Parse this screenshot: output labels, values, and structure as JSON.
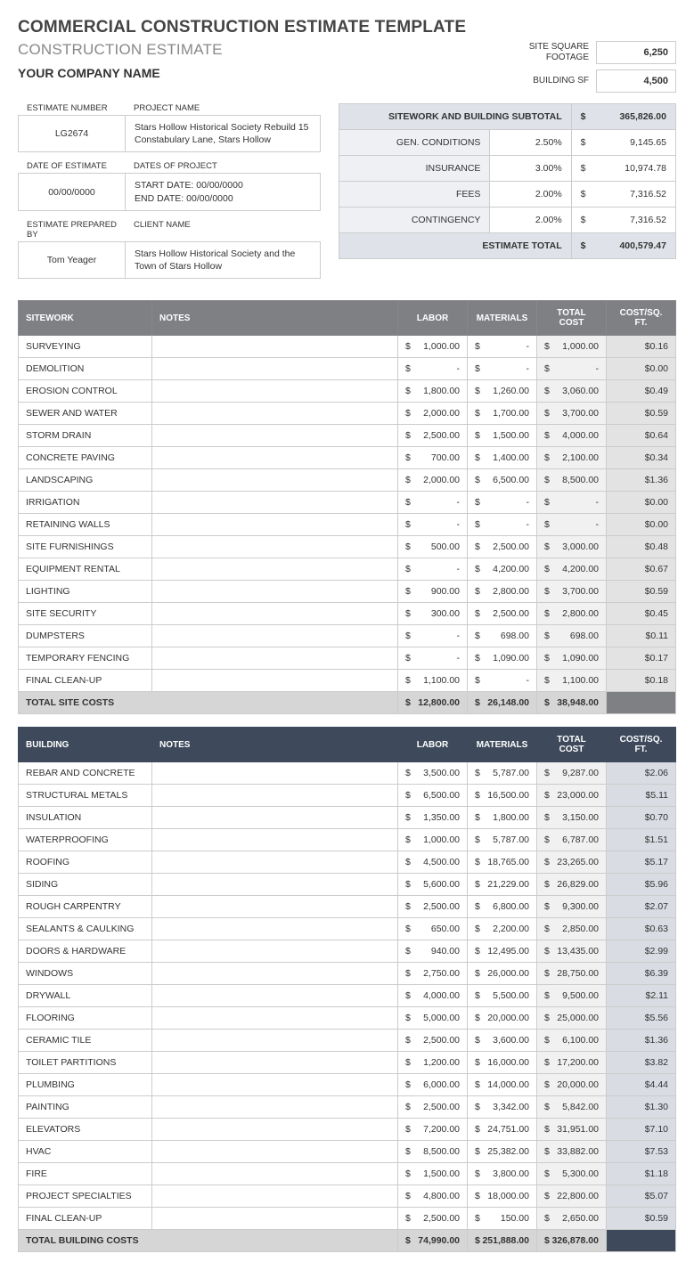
{
  "title": "COMMERCIAL CONSTRUCTION ESTIMATE TEMPLATE",
  "subtitle": "CONSTRUCTION ESTIMATE",
  "company": "YOUR COMPANY NAME",
  "sf": {
    "site_label": "SITE SQUARE FOOTAGE",
    "site_value": "6,250",
    "bldg_label": "BUILDING SF",
    "bldg_value": "4,500"
  },
  "meta": {
    "est_num_h": "ESTIMATE NUMBER",
    "proj_name_h": "PROJECT NAME",
    "est_num": "LG2674",
    "proj_name": "Stars Hollow Historical Society Rebuild 15 Constabulary Lane, Stars Hollow",
    "doe_h": "DATE OF ESTIMATE",
    "dop_h": "DATES OF PROJECT",
    "doe": "00/00/0000",
    "dop": "START DATE: 00/00/0000\nEND DATE: 00/00/0000",
    "prep_h": "ESTIMATE PREPARED BY",
    "client_h": "CLIENT NAME",
    "prep": "Tom Yeager",
    "client": "Stars Hollow Historical Society and the Town of Stars Hollow"
  },
  "summary": {
    "subtotal_label": "SITEWORK AND BUILDING SUBTOTAL",
    "subtotal": "365,826.00",
    "rows": [
      {
        "label": "GEN. CONDITIONS",
        "pct": "2.50%",
        "amt": "9,145.65"
      },
      {
        "label": "INSURANCE",
        "pct": "3.00%",
        "amt": "10,974.78"
      },
      {
        "label": "FEES",
        "pct": "2.00%",
        "amt": "7,316.52"
      },
      {
        "label": "CONTINGENCY",
        "pct": "2.00%",
        "amt": "7,316.52"
      }
    ],
    "total_label": "ESTIMATE TOTAL",
    "total": "400,579.47"
  },
  "cols": {
    "labor": "LABOR",
    "materials": "MATERIALS",
    "total": "TOTAL COST",
    "sqft": "COST/SQ. FT.",
    "notes": "NOTES"
  },
  "sitework": {
    "title": "SITEWORK",
    "rows": [
      {
        "name": "SURVEYING",
        "labor": "1,000.00",
        "materials": "-",
        "total": "1,000.00",
        "sqft": "$0.16"
      },
      {
        "name": "DEMOLITION",
        "labor": "-",
        "materials": "-",
        "total": "-",
        "sqft": "$0.00"
      },
      {
        "name": "EROSION CONTROL",
        "labor": "1,800.00",
        "materials": "1,260.00",
        "total": "3,060.00",
        "sqft": "$0.49"
      },
      {
        "name": "SEWER AND WATER",
        "labor": "2,000.00",
        "materials": "1,700.00",
        "total": "3,700.00",
        "sqft": "$0.59"
      },
      {
        "name": "STORM DRAIN",
        "labor": "2,500.00",
        "materials": "1,500.00",
        "total": "4,000.00",
        "sqft": "$0.64"
      },
      {
        "name": "CONCRETE PAVING",
        "labor": "700.00",
        "materials": "1,400.00",
        "total": "2,100.00",
        "sqft": "$0.34"
      },
      {
        "name": "LANDSCAPING",
        "labor": "2,000.00",
        "materials": "6,500.00",
        "total": "8,500.00",
        "sqft": "$1.36"
      },
      {
        "name": "IRRIGATION",
        "labor": "-",
        "materials": "-",
        "total": "-",
        "sqft": "$0.00"
      },
      {
        "name": "RETAINING WALLS",
        "labor": "-",
        "materials": "-",
        "total": "-",
        "sqft": "$0.00"
      },
      {
        "name": "SITE FURNISHINGS",
        "labor": "500.00",
        "materials": "2,500.00",
        "total": "3,000.00",
        "sqft": "$0.48"
      },
      {
        "name": "EQUIPMENT RENTAL",
        "labor": "-",
        "materials": "4,200.00",
        "total": "4,200.00",
        "sqft": "$0.67"
      },
      {
        "name": "LIGHTING",
        "labor": "900.00",
        "materials": "2,800.00",
        "total": "3,700.00",
        "sqft": "$0.59"
      },
      {
        "name": "SITE SECURITY",
        "labor": "300.00",
        "materials": "2,500.00",
        "total": "2,800.00",
        "sqft": "$0.45"
      },
      {
        "name": "DUMPSTERS",
        "labor": "-",
        "materials": "698.00",
        "total": "698.00",
        "sqft": "$0.11"
      },
      {
        "name": "TEMPORARY FENCING",
        "labor": "-",
        "materials": "1,090.00",
        "total": "1,090.00",
        "sqft": "$0.17"
      },
      {
        "name": "FINAL CLEAN-UP",
        "labor": "1,100.00",
        "materials": "-",
        "total": "1,100.00",
        "sqft": "$0.18"
      }
    ],
    "total_row": {
      "name": "TOTAL SITE COSTS",
      "labor": "12,800.00",
      "materials": "26,148.00",
      "total": "38,948.00"
    }
  },
  "building": {
    "title": "BUILDING",
    "rows": [
      {
        "name": "REBAR AND CONCRETE",
        "labor": "3,500.00",
        "materials": "5,787.00",
        "total": "9,287.00",
        "sqft": "$2.06"
      },
      {
        "name": "STRUCTURAL METALS",
        "labor": "6,500.00",
        "materials": "16,500.00",
        "total": "23,000.00",
        "sqft": "$5.11"
      },
      {
        "name": "INSULATION",
        "labor": "1,350.00",
        "materials": "1,800.00",
        "total": "3,150.00",
        "sqft": "$0.70"
      },
      {
        "name": "WATERPROOFING",
        "labor": "1,000.00",
        "materials": "5,787.00",
        "total": "6,787.00",
        "sqft": "$1.51"
      },
      {
        "name": "ROOFING",
        "labor": "4,500.00",
        "materials": "18,765.00",
        "total": "23,265.00",
        "sqft": "$5.17"
      },
      {
        "name": "SIDING",
        "labor": "5,600.00",
        "materials": "21,229.00",
        "total": "26,829.00",
        "sqft": "$5.96"
      },
      {
        "name": "ROUGH CARPENTRY",
        "labor": "2,500.00",
        "materials": "6,800.00",
        "total": "9,300.00",
        "sqft": "$2.07"
      },
      {
        "name": "SEALANTS & CAULKING",
        "labor": "650.00",
        "materials": "2,200.00",
        "total": "2,850.00",
        "sqft": "$0.63"
      },
      {
        "name": "DOORS & HARDWARE",
        "labor": "940.00",
        "materials": "12,495.00",
        "total": "13,435.00",
        "sqft": "$2.99"
      },
      {
        "name": "WINDOWS",
        "labor": "2,750.00",
        "materials": "26,000.00",
        "total": "28,750.00",
        "sqft": "$6.39"
      },
      {
        "name": "DRYWALL",
        "labor": "4,000.00",
        "materials": "5,500.00",
        "total": "9,500.00",
        "sqft": "$2.11"
      },
      {
        "name": "FLOORING",
        "labor": "5,000.00",
        "materials": "20,000.00",
        "total": "25,000.00",
        "sqft": "$5.56"
      },
      {
        "name": "CERAMIC TILE",
        "labor": "2,500.00",
        "materials": "3,600.00",
        "total": "6,100.00",
        "sqft": "$1.36"
      },
      {
        "name": "TOILET PARTITIONS",
        "labor": "1,200.00",
        "materials": "16,000.00",
        "total": "17,200.00",
        "sqft": "$3.82"
      },
      {
        "name": "PLUMBING",
        "labor": "6,000.00",
        "materials": "14,000.00",
        "total": "20,000.00",
        "sqft": "$4.44"
      },
      {
        "name": "PAINTING",
        "labor": "2,500.00",
        "materials": "3,342.00",
        "total": "5,842.00",
        "sqft": "$1.30"
      },
      {
        "name": "ELEVATORS",
        "labor": "7,200.00",
        "materials": "24,751.00",
        "total": "31,951.00",
        "sqft": "$7.10"
      },
      {
        "name": "HVAC",
        "labor": "8,500.00",
        "materials": "25,382.00",
        "total": "33,882.00",
        "sqft": "$7.53"
      },
      {
        "name": "FIRE",
        "labor": "1,500.00",
        "materials": "3,800.00",
        "total": "5,300.00",
        "sqft": "$1.18"
      },
      {
        "name": "PROJECT SPECIALTIES",
        "labor": "4,800.00",
        "materials": "18,000.00",
        "total": "22,800.00",
        "sqft": "$5.07"
      },
      {
        "name": "FINAL CLEAN-UP",
        "labor": "2,500.00",
        "materials": "150.00",
        "total": "2,650.00",
        "sqft": "$0.59"
      }
    ],
    "total_row": {
      "name": "TOTAL BUILDING COSTS",
      "labor": "74,990.00",
      "materials": "251,888.00",
      "total": "326,878.00"
    }
  }
}
